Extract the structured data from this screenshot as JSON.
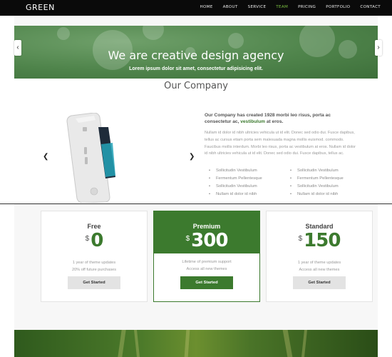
{
  "brand": {
    "logo": "GREEN",
    "accent": "#3c7a2e",
    "nav_active": "#7cc142"
  },
  "nav": {
    "items": [
      "HOME",
      "ABOUT",
      "SERVICE",
      "TEAM",
      "PRICING",
      "PORTFOLIO",
      "CONTACT"
    ],
    "active": "TEAM"
  },
  "hero": {
    "title": "We are creative design agency",
    "subtitle": "Lorem ipsum dolor sit amet, consectetur adipisicing elit.",
    "prev_icon": "chevron-left-icon",
    "next_icon": "chevron-right-icon"
  },
  "company": {
    "heading": "Our Company",
    "lead_pre": "Our Company has created 1928 morbi leo risus, porta ac consectetur ac, ",
    "lead_highlight": "vestibulum",
    "lead_post": " at eros.",
    "body": "Nullam id dolor id nibh ultricies vehicula ut id elit. Donec sed odio dui. Fusce dapibus, tellus ac cursus etiam porta sem malesuada magna mollis euismod. commodo. Faucibus mollis interdum. Morbi leo risus, porta ac vestibulum at eros. Nullam id dolor id nibh ultricies vehicula ut id elit. Donec sed odio dui. Fusce dapibus, tellus ac.",
    "bullets_left": [
      "Sollicitudin Vestibulum",
      "Fermentum Pellentesque",
      "Sollicitudin Vestibulum",
      "Nullam id dolor id nibh"
    ],
    "bullets_right": [
      "Sollicitudin Vestibulum",
      "Fermentum Pellentesque",
      "Sollicitudin Vestibulum",
      "Nullam id dolor id nibh"
    ]
  },
  "pricing": {
    "plans": [
      {
        "name": "Free",
        "currency": "$",
        "price": "0",
        "feature1": "1 year of theme updates",
        "feature2": "20% off future purchases",
        "button": "Get Started"
      },
      {
        "name": "Premium",
        "currency": "$",
        "price": "300",
        "feature1": "Lifetime of premium support",
        "feature2": "Access all new themes",
        "button": "Get Started"
      },
      {
        "name": "Standard",
        "currency": "$",
        "price": "150",
        "feature1": "1 year of theme updates",
        "feature2": "Access all new themes",
        "button": "Get Started"
      }
    ]
  }
}
